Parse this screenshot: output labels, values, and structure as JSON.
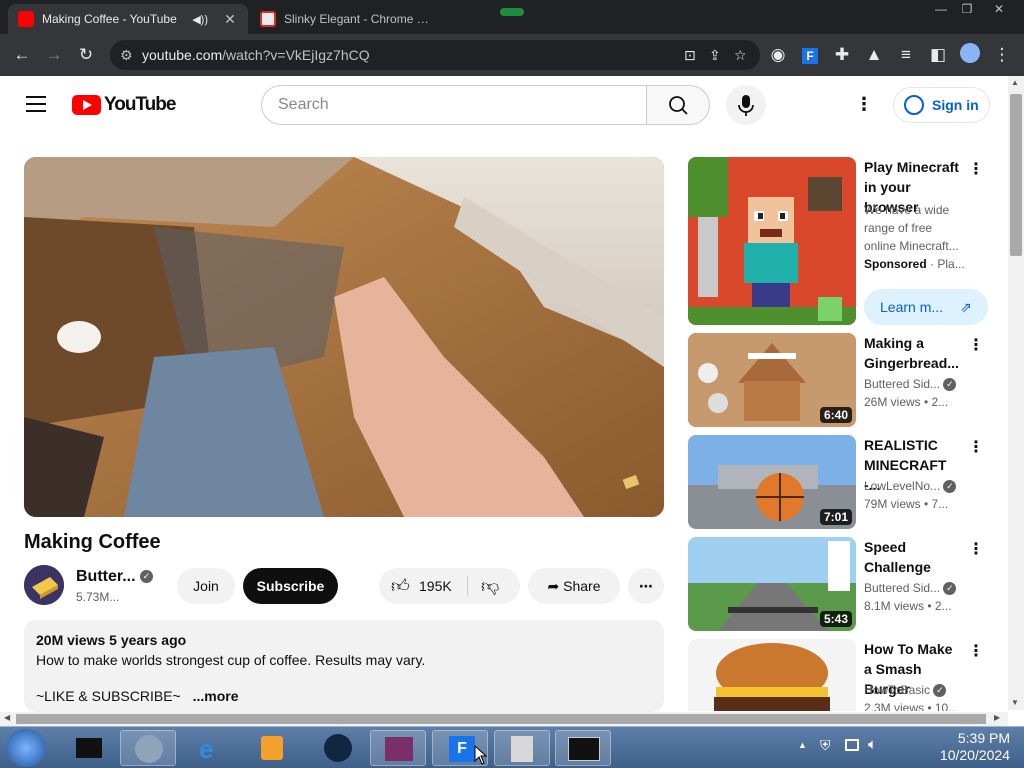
{
  "browser": {
    "tabs": [
      {
        "title": "Making Coffee - YouTube",
        "active": true
      },
      {
        "title": "Slinky Elegant - Chrome We",
        "active": false
      }
    ],
    "url_host": "youtube.com",
    "url_path": "/watch?v=VkEjIgz7hCQ"
  },
  "youtube": {
    "search_placeholder": "Search",
    "sign_in": "Sign in",
    "video": {
      "title": "Making Coffee",
      "channel": "Butter...",
      "subscribers": "5.73M...",
      "join": "Join",
      "subscribe": "Subscribe",
      "likes": "195K",
      "share": "Share",
      "stats": "20M views  5 years ago",
      "description_line1": "How to make worlds strongest cup of coffee. Results may vary.",
      "description_line2": "~LIKE & SUBSCRIBE~",
      "more": "...more"
    },
    "recommendations": [
      {
        "title": "Play Minecraft in your browser",
        "desc": "We have a wide range of free online Minecraft...",
        "sponsored": "Sponsored",
        "sponsor_tail": "· Pla...",
        "cta": "Learn m..."
      },
      {
        "title": "Making a Gingerbread...",
        "channel": "Buttered Sid...",
        "meta": "26M views  •  2...",
        "duration": "6:40"
      },
      {
        "title": "REALISTIC MINECRAFT -...",
        "channel": "LowLevelNo...",
        "meta": "79M views  •  7...",
        "duration": "7:01"
      },
      {
        "title": "Speed Challenge",
        "channel": "Buttered Sid...",
        "meta": "8.1M views  •  2...",
        "duration": "5:43"
      },
      {
        "title": "How To Make a Smash Burger",
        "channel": "HowToBasic",
        "meta": "2.3M views  •  10..."
      }
    ]
  },
  "taskbar": {
    "time": "5:39 PM",
    "date": "10/20/2024"
  }
}
